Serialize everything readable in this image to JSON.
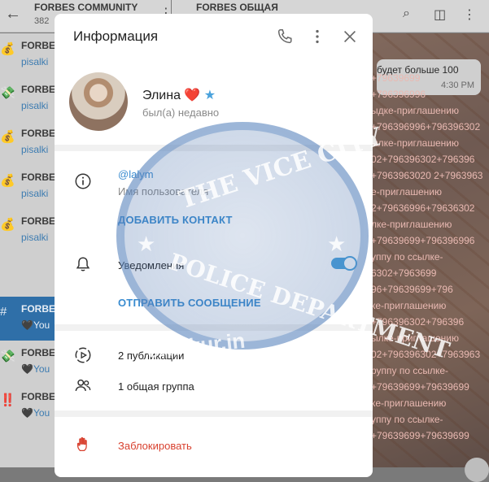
{
  "left_panel": {
    "title": "FORBES COMMUNITY",
    "subtitle": "382",
    "items": [
      {
        "emoji": "💰",
        "name": "FORBES",
        "msg": "pisalki"
      },
      {
        "emoji": "💸",
        "name": "FORBES",
        "msg": "pisalki"
      },
      {
        "emoji": "💰",
        "name": "FORBES",
        "msg": "pisalki"
      },
      {
        "emoji": "💰",
        "name": "FORBES",
        "msg": "pisalki"
      },
      {
        "emoji": "💰",
        "name": "FORBES",
        "msg": "pisalki"
      },
      {
        "emoji": "#",
        "name": "FORBES",
        "msg": "🖤You"
      },
      {
        "emoji": "💸",
        "name": "FORBES",
        "msg": "🖤You"
      },
      {
        "emoji": "‼️",
        "name": "FORBES",
        "msg": "🖤You"
      }
    ]
  },
  "chat": {
    "title": "FORBES ОБЩАЯ",
    "bubble_text": "будет больше 100",
    "bubble_time": "4:30 PM",
    "spam_lines": [
      "+79639699",
      "+796396996",
      "ыдке-приглашению",
      "+796396996+796396302",
      "ылке-приглашению",
      "02+796396302+796396",
      "+7963963020 2+7963963",
      "е-приглашению",
      "2+79636996+79636302",
      "лке-приглашению",
      "+79639699+796396996",
      "уппу по ссылке-",
      "6302+7963699",
      "96+79639699+796",
      "ке-приглашению",
      "+796396302+796396",
      "ылке-приглашению",
      "02+796396302+7963963",
      "руппу по ссылке-",
      "+79639699+79639699",
      "ке-приглашению",
      "уппу по ссылке-",
      "+79639699+79639699"
    ]
  },
  "modal": {
    "title": "Информация",
    "profile": {
      "name": "Элина ❤️",
      "badge": "★",
      "status": "был(а) недавно"
    },
    "username": {
      "value": "@lalym",
      "label": "Имя пользователя"
    },
    "add_contact_label": "ДОБАВИТЬ КОНТАКТ",
    "notifications": {
      "label": "Уведомления",
      "enabled": true
    },
    "send_message_label": "ОТПРАВИТЬ СООБЩЕНИЕ",
    "posts_label": "2 публикации",
    "groups_label": "1 общая группа",
    "block_label": "Заблокировать"
  },
  "watermark": {
    "top": "THE VICE CITY",
    "bottom": "POLICE DEPARTMENT",
    "site": "oksikur.in"
  },
  "colors": {
    "accent": "#3a8cd0",
    "danger": "#d8412f",
    "toggle": "#4aa2dc"
  }
}
